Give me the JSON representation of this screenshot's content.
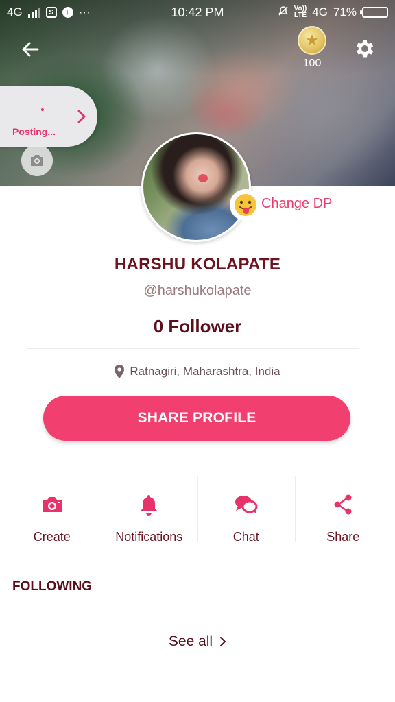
{
  "status_bar": {
    "network": "4G",
    "time": "10:42 PM",
    "volte_line1": "Vo))",
    "volte_line2": "LTE",
    "network2": "4G",
    "battery": "71%",
    "battery_level": 0.71,
    "more": "···"
  },
  "header": {
    "coins": "100",
    "posting_label": "Posting..."
  },
  "profile": {
    "change_dp_label": "Change DP",
    "change_dp_emoji": "😛",
    "name": "HARSHU KOLAPATE",
    "handle": "@harshukolapate",
    "followers": "0 Follower",
    "location": "Ratnagiri, Maharashtra, India",
    "share_button": "SHARE PROFILE"
  },
  "actions": [
    {
      "label": "Create",
      "icon": "camera-icon"
    },
    {
      "label": "Notifications",
      "icon": "bell-icon"
    },
    {
      "label": "Chat",
      "icon": "chat-icon"
    },
    {
      "label": "Share",
      "icon": "share-icon"
    }
  ],
  "following": {
    "title": "FOLLOWING",
    "see_all": "See all"
  },
  "colors": {
    "accent": "#f1406f",
    "dark_text": "#5b0f1c",
    "icon_pink": "#e8336a"
  }
}
